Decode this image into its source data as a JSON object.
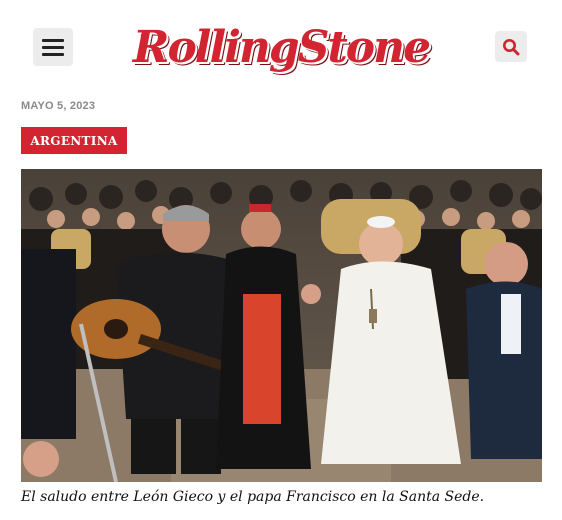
{
  "header": {
    "logo_text": "RollingStone",
    "menu_icon": "hamburger-menu-icon",
    "search_icon": "search-icon"
  },
  "article": {
    "date": "MAYO 5, 2023",
    "category": "ARGENTINA",
    "image_alt": "Photo of León Gieco greeting Pope Francis",
    "caption": "El saludo entre León Gieco y el papa Francisco en la Santa Sede."
  },
  "colors": {
    "brand_red": "#d32531",
    "button_bg": "#ececec",
    "date_gray": "#8a8a8a"
  }
}
